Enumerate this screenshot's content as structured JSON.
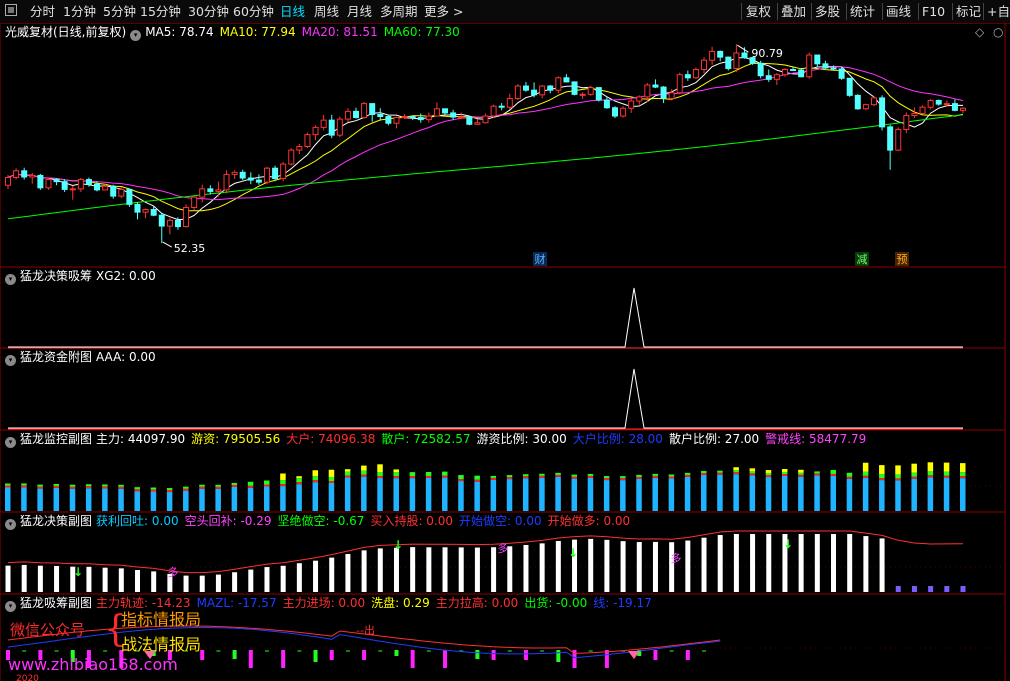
{
  "toolbar": {
    "periods": [
      "分时",
      "1分钟",
      "5分钟",
      "15分钟",
      "30分钟",
      "60分钟",
      "日线",
      "周线",
      "月线",
      "多周期",
      "更多 >"
    ],
    "active_period": "日线",
    "right_buttons": [
      "复权",
      "叠加",
      "多股",
      "统计",
      "画线",
      "F10",
      "标记",
      "+自选"
    ]
  },
  "main_panel": {
    "title": "光威复材(日线,前复权)",
    "ma": [
      {
        "label": "MA5: 78.74",
        "color": "#ffffff"
      },
      {
        "label": "MA10: 77.94",
        "color": "#ffff00"
      },
      {
        "label": "MA20: 81.51",
        "color": "#ff33ff"
      },
      {
        "label": "MA60: 77.30",
        "color": "#00ff00"
      }
    ],
    "high_label": "90.79",
    "low_label": "52.35",
    "markers": [
      {
        "text": "财",
        "color": "#5ab4ff",
        "bg": "#0a2a55"
      },
      {
        "text": "减",
        "color": "#6cff6c",
        "bg": "#0a3a0a"
      },
      {
        "text": "预",
        "color": "#ffb020",
        "bg": "#4a2400"
      }
    ]
  },
  "candles": [
    [
      63.5,
      65.5,
      62.8,
      65.0
    ],
    [
      65.0,
      66.8,
      64.6,
      66.3
    ],
    [
      66.3,
      66.9,
      64.6,
      65.1
    ],
    [
      65.1,
      65.9,
      63.8,
      65.4
    ],
    [
      65.4,
      65.7,
      62.6,
      63.0
    ],
    [
      63.0,
      64.9,
      62.6,
      64.6
    ],
    [
      64.6,
      64.9,
      63.5,
      64.2
    ],
    [
      64.2,
      64.7,
      62.2,
      62.7
    ],
    [
      62.7,
      63.4,
      60.7,
      62.8
    ],
    [
      62.8,
      64.9,
      62.2,
      64.6
    ],
    [
      64.6,
      65.0,
      63.2,
      63.7
    ],
    [
      63.7,
      64.3,
      62.3,
      62.6
    ],
    [
      62.6,
      63.8,
      62.5,
      63.3
    ],
    [
      63.3,
      63.6,
      60.9,
      61.4
    ],
    [
      61.4,
      63.1,
      61.0,
      62.7
    ],
    [
      62.7,
      62.9,
      59.3,
      59.8
    ],
    [
      59.8,
      60.2,
      56.9,
      58.3
    ],
    [
      58.3,
      59.0,
      57.1,
      58.8
    ],
    [
      58.8,
      59.4,
      57.5,
      57.7
    ],
    [
      57.7,
      58.2,
      52.3,
      55.6
    ],
    [
      55.6,
      57.2,
      54.0,
      56.7
    ],
    [
      56.7,
      57.3,
      54.9,
      55.5
    ],
    [
      55.5,
      59.8,
      55.3,
      59.2
    ],
    [
      59.2,
      61.4,
      58.6,
      61.2
    ],
    [
      61.2,
      63.6,
      60.2,
      62.8
    ],
    [
      62.8,
      63.5,
      61.7,
      62.3
    ],
    [
      62.3,
      64.2,
      61.3,
      62.6
    ],
    [
      62.6,
      66.4,
      61.9,
      65.6
    ],
    [
      65.6,
      66.4,
      64.7,
      66.0
    ],
    [
      66.0,
      66.5,
      64.5,
      64.9
    ],
    [
      64.9,
      66.0,
      63.7,
      64.5
    ],
    [
      64.5,
      65.6,
      63.6,
      64.1
    ],
    [
      64.1,
      67.1,
      63.7,
      66.8
    ],
    [
      66.8,
      67.3,
      64.3,
      64.8
    ],
    [
      64.8,
      68.0,
      64.3,
      67.6
    ],
    [
      67.6,
      70.7,
      67.3,
      70.3
    ],
    [
      70.3,
      71.5,
      69.5,
      71.0
    ],
    [
      71.0,
      73.7,
      70.7,
      73.3
    ],
    [
      73.3,
      75.1,
      72.2,
      74.7
    ],
    [
      74.7,
      77.1,
      74.1,
      76.1
    ],
    [
      76.1,
      77.1,
      72.6,
      73.2
    ],
    [
      73.2,
      76.8,
      72.8,
      76.3
    ],
    [
      76.3,
      78.4,
      75.7,
      77.8
    ],
    [
      77.8,
      78.5,
      76.4,
      76.6
    ],
    [
      76.6,
      79.6,
      76.4,
      79.3
    ],
    [
      79.3,
      79.3,
      75.8,
      77.2
    ],
    [
      77.2,
      78.4,
      76.2,
      76.8
    ],
    [
      76.8,
      77.2,
      75.1,
      75.5
    ],
    [
      75.5,
      76.8,
      74.5,
      76.6
    ],
    [
      76.6,
      77.3,
      76.3,
      76.8
    ],
    [
      76.8,
      76.9,
      76.1,
      76.6
    ],
    [
      76.6,
      77.4,
      75.6,
      76.2
    ],
    [
      76.2,
      77.6,
      75.6,
      76.9
    ],
    [
      76.9,
      79.5,
      76.8,
      78.3
    ],
    [
      78.3,
      78.3,
      77.1,
      77.5
    ],
    [
      77.5,
      78.1,
      76.1,
      76.7
    ],
    [
      76.7,
      77.6,
      76.3,
      76.7
    ],
    [
      76.7,
      77.0,
      75.1,
      75.3
    ],
    [
      75.3,
      76.3,
      75.2,
      75.6
    ],
    [
      75.6,
      77.4,
      75.5,
      76.9
    ],
    [
      76.9,
      79.1,
      76.5,
      78.8
    ],
    [
      78.8,
      79.4,
      78.0,
      78.6
    ],
    [
      78.6,
      81.2,
      78.2,
      80.3
    ],
    [
      80.3,
      83.1,
      80.0,
      82.7
    ],
    [
      82.7,
      83.5,
      81.6,
      81.9
    ],
    [
      81.9,
      83.4,
      80.5,
      81.0
    ],
    [
      81.0,
      82.9,
      80.3,
      82.7
    ],
    [
      82.7,
      82.9,
      81.3,
      81.9
    ],
    [
      81.9,
      84.6,
      81.3,
      84.3
    ],
    [
      84.3,
      85.0,
      83.4,
      83.5
    ],
    [
      83.5,
      83.6,
      80.9,
      81.1
    ],
    [
      81.1,
      81.5,
      80.2,
      81.1
    ],
    [
      81.1,
      82.7,
      80.8,
      82.4
    ],
    [
      82.4,
      82.4,
      79.7,
      80.0
    ],
    [
      80.0,
      80.5,
      78.3,
      78.5
    ],
    [
      78.5,
      78.8,
      76.5,
      76.9
    ],
    [
      76.9,
      78.8,
      76.6,
      78.4
    ],
    [
      78.4,
      80.5,
      77.5,
      79.8
    ],
    [
      79.8,
      80.9,
      79.1,
      80.6
    ],
    [
      80.6,
      83.3,
      79.6,
      82.9
    ],
    [
      82.9,
      84.0,
      82.3,
      82.5
    ],
    [
      82.5,
      82.7,
      79.4,
      80.3
    ],
    [
      80.3,
      82.1,
      79.9,
      81.4
    ],
    [
      81.4,
      85.3,
      81.1,
      84.9
    ],
    [
      84.9,
      85.7,
      83.7,
      84.3
    ],
    [
      84.3,
      86.3,
      84.1,
      85.9
    ],
    [
      85.9,
      88.3,
      85.2,
      87.7
    ],
    [
      87.7,
      90.3,
      86.8,
      89.4
    ],
    [
      89.4,
      89.6,
      87.5,
      88.3
    ],
    [
      88.3,
      88.4,
      85.7,
      86.1
    ],
    [
      86.1,
      90.8,
      85.4,
      89.1
    ],
    [
      89.1,
      90.2,
      88.0,
      88.2
    ],
    [
      88.2,
      88.3,
      86.8,
      87.1
    ],
    [
      87.1,
      87.6,
      84.2,
      84.7
    ],
    [
      84.7,
      85.9,
      83.5,
      84.0
    ],
    [
      84.0,
      85.2,
      82.9,
      84.9
    ],
    [
      84.9,
      86.2,
      84.5,
      85.9
    ],
    [
      85.9,
      86.4,
      85.6,
      85.8
    ],
    [
      85.8,
      86.2,
      84.4,
      84.5
    ],
    [
      84.5,
      89.2,
      84.1,
      88.7
    ],
    [
      88.7,
      88.7,
      86.3,
      87.0
    ],
    [
      87.0,
      87.6,
      86.0,
      86.2
    ],
    [
      86.2,
      86.7,
      85.8,
      86.0
    ],
    [
      86.0,
      86.4,
      83.9,
      84.2
    ],
    [
      84.2,
      84.2,
      80.6,
      80.9
    ],
    [
      80.9,
      81.1,
      78.1,
      78.3
    ],
    [
      78.3,
      79.3,
      78.0,
      79.1
    ],
    [
      79.1,
      80.8,
      78.8,
      80.4
    ],
    [
      80.4,
      80.9,
      74.1,
      74.8
    ],
    [
      74.8,
      75.2,
      66.5,
      70.3
    ],
    [
      70.3,
      74.7,
      70.1,
      74.3
    ],
    [
      74.3,
      77.6,
      73.6,
      77.0
    ],
    [
      77.0,
      78.6,
      76.5,
      77.4
    ],
    [
      77.4,
      79.0,
      77.2,
      78.6
    ],
    [
      78.6,
      80.2,
      78.2,
      79.9
    ],
    [
      79.9,
      80.1,
      78.9,
      79.2
    ],
    [
      79.2,
      79.9,
      78.7,
      79.3
    ],
    [
      79.3,
      80.1,
      77.8,
      78.0
    ],
    [
      78.0,
      78.6,
      77.5,
      78.4
    ]
  ],
  "panels": [
    {
      "title": "猛龙决策吸筹",
      "items": [
        {
          "text": "XG2: 0.00",
          "color": "#ffffff"
        }
      ]
    },
    {
      "title": "猛龙资金附图",
      "items": [
        {
          "text": "AAA: 0.00",
          "color": "#ffffff"
        }
      ]
    },
    {
      "title": "猛龙监控副图",
      "items": [
        {
          "text": "主力: 44097.90",
          "color": "#ffffff"
        },
        {
          "text": "游资: 79505.56",
          "color": "#ffff00"
        },
        {
          "text": "大户: 74096.38",
          "color": "#ff3030"
        },
        {
          "text": "散户: 72582.57",
          "color": "#00ff00"
        },
        {
          "text": "游资比例: 30.00",
          "color": "#ffffff"
        },
        {
          "text": "大户比例: 28.00",
          "color": "#1e3cff"
        },
        {
          "text": "散户比例: 27.00",
          "color": "#ffffff"
        },
        {
          "text": "警戒线: 58477.79",
          "color": "#ff44ff"
        }
      ]
    },
    {
      "title": "猛龙决策副图",
      "items": [
        {
          "text": "获利回吐: 0.00",
          "color": "#00ccff"
        },
        {
          "text": "空头回补: -0.29",
          "color": "#ff44ff"
        },
        {
          "text": "坚绝做空: -0.67",
          "color": "#00ff00"
        },
        {
          "text": "买入持股: 0.00",
          "color": "#ff3030"
        },
        {
          "text": "开始做空: 0.00",
          "color": "#1e3cff"
        },
        {
          "text": "开始做多: 0.00",
          "color": "#ff3030"
        }
      ]
    },
    {
      "title": "猛龙吸筹副图",
      "items": [
        {
          "text": "主力轨迹: -14.23",
          "color": "#ff3030"
        },
        {
          "text": "MAZL: -17.57",
          "color": "#1e3cff"
        },
        {
          "text": "主力进场: 0.00",
          "color": "#ff3030"
        },
        {
          "text": "洗盘: 0.29",
          "color": "#ffff00"
        },
        {
          "text": "主力拉高: 0.00",
          "color": "#ff3030"
        },
        {
          "text": "出货: -0.00",
          "color": "#00ff00"
        },
        {
          "text": "线: -19.17",
          "color": "#1e3cff"
        }
      ]
    }
  ],
  "panel5_labels": {
    "go": "多",
    "out": "--出"
  },
  "watermark": {
    "wechat": "微信公众号",
    "brand1": "指标情报局",
    "brand2": "战法情报局",
    "url": "www.zhibiao168.com"
  },
  "bottom_date": "2020"
}
